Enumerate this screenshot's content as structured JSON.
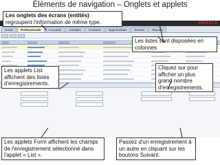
{
  "slide": {
    "title": "Éléments de navigation – Onglets et applets"
  },
  "app": {
    "logo": "ORACLE",
    "tabs": [
      "Home",
      "Professionals",
      "Accounts",
      "Activities",
      "Contacts",
      "Opportunities",
      "Service",
      "Reports"
    ],
    "active_tab_index": 1
  },
  "callouts": {
    "tabs_title": "Les onglets des écrans (entités)",
    "tabs_text": "regroupent l'information de même type.",
    "lists_columns": "Les listes sont disposées en colonnes.",
    "list_applets": "Les applets List affichent des listes d'enregistrements.",
    "click_more": "Cliquez sur pour afficher un plus grand nombre d'enregistrements.",
    "form_applets": "Les applets Form affichent les champs de l'enregistrement sélectionné dans l'applet « List ».",
    "next_record": "Passez d'un enregistrement à un autre en cliquant sur les boutons Suivant."
  }
}
